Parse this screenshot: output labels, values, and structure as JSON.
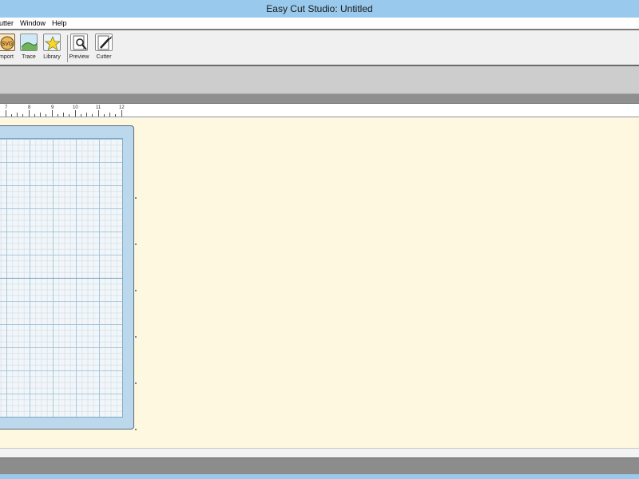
{
  "window": {
    "title": "Easy Cut Studio: Untitled"
  },
  "menu": {
    "items": [
      {
        "label": "utter"
      },
      {
        "label": "Window"
      },
      {
        "label": "Help"
      }
    ]
  },
  "toolbar": {
    "items": [
      {
        "label": "mport",
        "icon": "import-icon"
      },
      {
        "label": "Trace",
        "icon": "trace-icon"
      },
      {
        "label": "Library",
        "icon": "library-icon"
      },
      {
        "label": "Preview",
        "icon": "preview-icon"
      },
      {
        "label": "Cutter",
        "icon": "cutter-icon"
      }
    ]
  },
  "ruler": {
    "labels": [
      "7",
      "8",
      "9",
      "10",
      "11",
      "12"
    ]
  },
  "colors": {
    "titlebar": "#99c9ec",
    "canvas": "#fef8e0",
    "mat": "#bcd8ec",
    "grid": "#f2f6f8"
  }
}
